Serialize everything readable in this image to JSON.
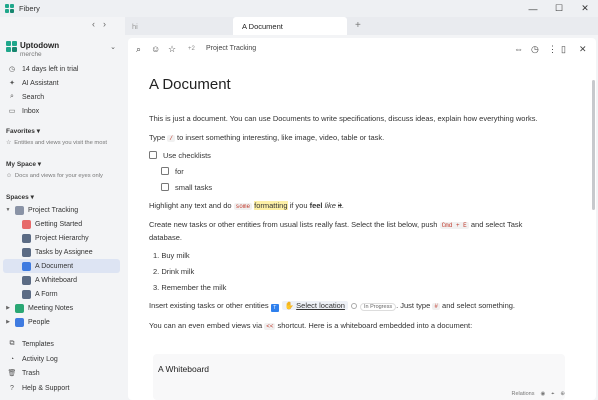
{
  "window": {
    "app_title": "Fibery",
    "controls": [
      "—",
      "☐",
      "✕"
    ]
  },
  "tabs": [
    {
      "label": "hi",
      "active": false
    },
    {
      "label": "A Document",
      "active": true
    }
  ],
  "workspace": {
    "name": "Uptodown",
    "user": "merche"
  },
  "sidebar": {
    "top_items": [
      {
        "label": "14 days left in trial",
        "icon": "clock-icon"
      },
      {
        "label": "AI Assistant",
        "icon": "sparkle-icon"
      },
      {
        "label": "Search",
        "icon": "search-icon"
      },
      {
        "label": "Inbox",
        "icon": "inbox-icon"
      }
    ],
    "favorites": {
      "title": "Favorites",
      "desc": "Entities and views you visit the most"
    },
    "myspace": {
      "title": "My Space",
      "desc": "Docs and views for your eyes only"
    },
    "spaces_title": "Spaces",
    "tree": [
      {
        "label": "Project Tracking",
        "level": 0,
        "icon_color": "#8a93a6"
      },
      {
        "label": "Getting Started",
        "level": 1,
        "icon_color": "#e76a6a"
      },
      {
        "label": "Project Hierarchy",
        "level": 1,
        "icon_color": "#5b6b84"
      },
      {
        "label": "Tasks by Assignee",
        "level": 1,
        "icon_color": "#5b6b84"
      },
      {
        "label": "A Document",
        "level": 1,
        "icon_color": "#3f7be0",
        "active": true
      },
      {
        "label": "A Whiteboard",
        "level": 1,
        "icon_color": "#5b6b84"
      },
      {
        "label": "A Form",
        "level": 1,
        "icon_color": "#5b6b84"
      },
      {
        "label": "Meeting Notes",
        "level": 0,
        "icon_color": "#2aa774"
      },
      {
        "label": "People",
        "level": 0,
        "icon_color": "#3f7be0"
      }
    ],
    "bottom_items": [
      {
        "label": "Templates",
        "icon": "templates-icon"
      },
      {
        "label": "Activity Log",
        "icon": "activity-icon"
      },
      {
        "label": "Trash",
        "icon": "trash-icon"
      },
      {
        "label": "Help & Support",
        "icon": "help-icon"
      }
    ]
  },
  "toolbar": {
    "collaborators": "+2",
    "breadcrumb": "Project Tracking"
  },
  "document": {
    "title": "A Document",
    "intro": "This is just a document. You can use Documents to write specifications, discuss ideas, explain how everything works.",
    "type_pre": "Type ",
    "type_code": "/",
    "type_post": " to insert something interesting, like image, video, table or task.",
    "checklist": [
      {
        "label": "Use checklists",
        "indent": 0
      },
      {
        "label": "for",
        "indent": 1
      },
      {
        "label": "small tasks",
        "indent": 1
      }
    ],
    "highlight": {
      "pre": "Highlight any text and do ",
      "code": "some",
      "space": " ",
      "hl": "formatting",
      "mid": " if you ",
      "bold": "feel",
      "space2": " ",
      "italic": "like",
      "space3": " ",
      "strike": "it",
      "end": "."
    },
    "create_1_pre": "Create new tasks or other entities from usual lists really fast. Select the list below, push ",
    "create_1_code": "Cmd + E",
    "create_1_post": " and select Task",
    "create_2": "database.",
    "numbered": [
      "Buy milk",
      "Drink milk",
      "Remember the milk"
    ],
    "insert_pre": "Insert existing tasks or other entities",
    "insert_badge": "T",
    "insert_entity": "Select location",
    "insert_status": "In Progress",
    "insert_mid": ". Just type ",
    "insert_code": "#",
    "insert_post": " and select something.",
    "embed_pre": "You can an even embed views via ",
    "embed_code": "<<",
    "embed_post": " shortcut. Here is a whiteboard embedded into a document:",
    "embed_title": "A Whiteboard",
    "embed_toolbar": "Relations"
  }
}
